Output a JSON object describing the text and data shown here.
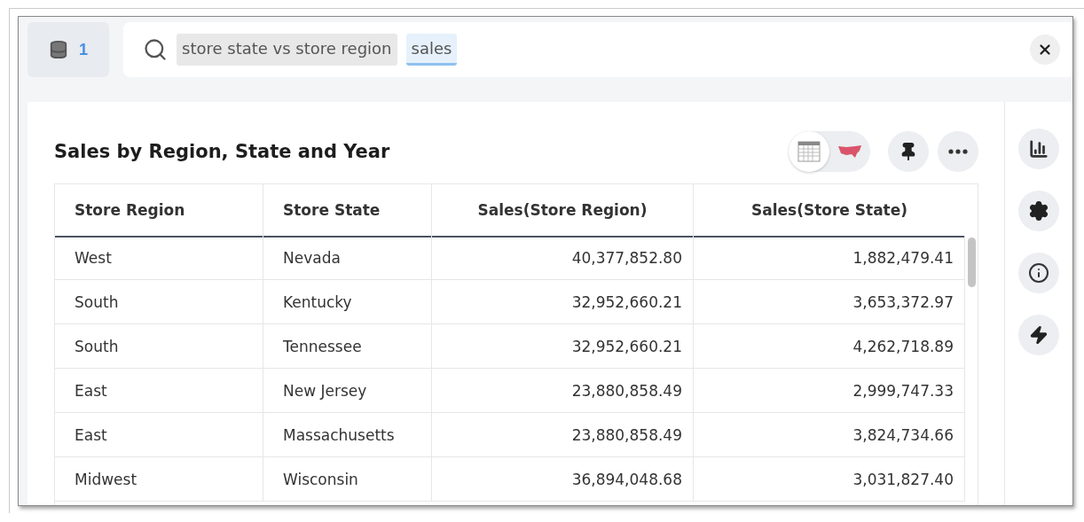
{
  "source_button": {
    "count": "1"
  },
  "search": {
    "tokens": [
      {
        "text": "store state vs store region",
        "selected": false
      },
      {
        "text": "sales",
        "selected": true
      }
    ]
  },
  "answer": {
    "title": "Sales by Region, State and Year",
    "views": [
      {
        "kind": "table",
        "selected": true
      },
      {
        "kind": "map",
        "selected": false
      }
    ],
    "table": {
      "columns": [
        "Store Region",
        "Store State",
        "Sales(Store Region)",
        "Sales(Store State)"
      ],
      "rows": [
        [
          "West",
          "Nevada",
          "40,377,852.80",
          "1,882,479.41"
        ],
        [
          "South",
          "Kentucky",
          "32,952,660.21",
          "3,653,372.97"
        ],
        [
          "South",
          "Tennessee",
          "32,952,660.21",
          "4,262,718.89"
        ],
        [
          "East",
          "New Jersey",
          "23,880,858.49",
          "2,999,747.33"
        ],
        [
          "East",
          "Massachusetts",
          "23,880,858.49",
          "3,824,734.66"
        ],
        [
          "Midwest",
          "Wisconsin",
          "36,894,048.68",
          "3,031,827.40"
        ]
      ]
    }
  },
  "rail": [
    {
      "kind": "chart"
    },
    {
      "kind": "settings"
    },
    {
      "kind": "info"
    },
    {
      "kind": "bolt"
    }
  ]
}
